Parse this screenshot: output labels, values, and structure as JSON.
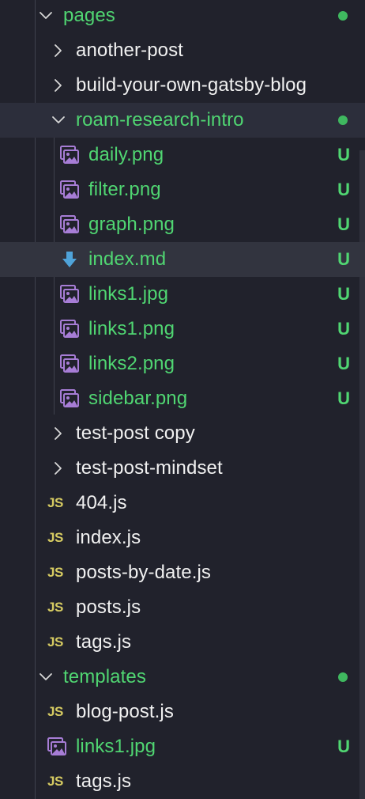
{
  "explorer": {
    "rows": [
      {
        "label": "pages",
        "kind": "folder",
        "expanded": true,
        "depth": 0,
        "git": "dot",
        "color": "untracked"
      },
      {
        "label": "another-post",
        "kind": "folder",
        "expanded": false,
        "depth": 1,
        "git": "",
        "color": "plain"
      },
      {
        "label": "build-your-own-gatsby-blog",
        "kind": "folder",
        "expanded": false,
        "depth": 1,
        "git": "",
        "color": "plain"
      },
      {
        "label": "roam-research-intro",
        "kind": "folder",
        "expanded": true,
        "depth": 1,
        "git": "dot",
        "color": "untracked",
        "state": "hover"
      },
      {
        "label": "daily.png",
        "kind": "image",
        "depth": 2,
        "git": "U",
        "color": "untracked"
      },
      {
        "label": "filter.png",
        "kind": "image",
        "depth": 2,
        "git": "U",
        "color": "untracked"
      },
      {
        "label": "graph.png",
        "kind": "image",
        "depth": 2,
        "git": "U",
        "color": "untracked"
      },
      {
        "label": "index.md",
        "kind": "markdown",
        "depth": 2,
        "git": "U",
        "color": "untracked",
        "state": "active"
      },
      {
        "label": "links1.jpg",
        "kind": "image",
        "depth": 2,
        "git": "U",
        "color": "untracked"
      },
      {
        "label": "links1.png",
        "kind": "image",
        "depth": 2,
        "git": "U",
        "color": "untracked"
      },
      {
        "label": "links2.png",
        "kind": "image",
        "depth": 2,
        "git": "U",
        "color": "untracked"
      },
      {
        "label": "sidebar.png",
        "kind": "image",
        "depth": 2,
        "git": "U",
        "color": "untracked"
      },
      {
        "label": "test-post copy",
        "kind": "folder",
        "expanded": false,
        "depth": 1,
        "git": "",
        "color": "plain"
      },
      {
        "label": "test-post-mindset",
        "kind": "folder",
        "expanded": false,
        "depth": 1,
        "git": "",
        "color": "plain"
      },
      {
        "label": "404.js",
        "kind": "js",
        "depth": 1,
        "git": "",
        "color": "plain"
      },
      {
        "label": "index.js",
        "kind": "js",
        "depth": 1,
        "git": "",
        "color": "plain"
      },
      {
        "label": "posts-by-date.js",
        "kind": "js",
        "depth": 1,
        "git": "",
        "color": "plain"
      },
      {
        "label": "posts.js",
        "kind": "js",
        "depth": 1,
        "git": "",
        "color": "plain"
      },
      {
        "label": "tags.js",
        "kind": "js",
        "depth": 1,
        "git": "",
        "color": "plain"
      },
      {
        "label": "templates",
        "kind": "folder",
        "expanded": true,
        "depth": 0,
        "git": "dot",
        "color": "untracked"
      },
      {
        "label": "blog-post.js",
        "kind": "js",
        "depth": 1,
        "git": "",
        "color": "plain"
      },
      {
        "label": "links1.jpg",
        "kind": "image",
        "depth": 1,
        "git": "U",
        "color": "untracked"
      },
      {
        "label": "tags.js",
        "kind": "js",
        "depth": 1,
        "git": "",
        "color": "plain"
      }
    ]
  },
  "icons": {
    "js_glyph": "JS",
    "folder_open": "chevron-down-icon",
    "folder_closed": "chevron-right-icon",
    "image": "image-file-icon",
    "markdown": "markdown-download-icon"
  },
  "colors": {
    "background": "#21222c",
    "untracked_text": "#50d672",
    "plain_text": "#f1f1f1",
    "js_icon": "#d6cb62",
    "image_icon": "#a77dd6",
    "markdown_icon": "#4fa3d9",
    "git_dot": "#3fb85f"
  }
}
